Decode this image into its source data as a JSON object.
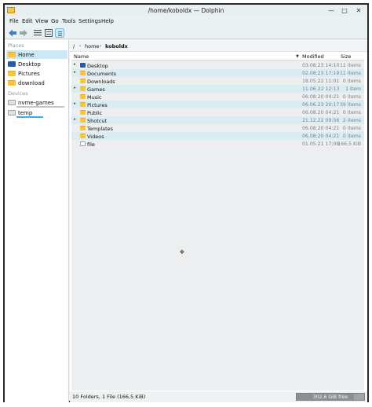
{
  "window": {
    "title": "/home/koboldx — Dolphin",
    "controls": {
      "minimize": "—",
      "maximize": "□",
      "close": "✕"
    }
  },
  "menubar": [
    "File",
    "Edit",
    "View",
    "Go",
    "Tools",
    "Settings",
    "Help"
  ],
  "toolbar": [
    "back-icon",
    "forward-icon",
    "icons-view-icon",
    "compact-view-icon",
    "details-view-icon"
  ],
  "sidebar": {
    "places_title": "Places",
    "places": [
      {
        "label": "Home",
        "icon": "home-folder-icon",
        "selected": true
      },
      {
        "label": "Desktop",
        "icon": "desktop-folder-icon",
        "selected": false
      },
      {
        "label": "Pictures",
        "icon": "pictures-folder-icon",
        "selected": false
      },
      {
        "label": "download",
        "icon": "download-folder-icon",
        "selected": false
      }
    ],
    "devices_title": "Devices",
    "devices": [
      {
        "label": "nvme-games",
        "icon": "drive-icon",
        "used_fraction": 0.98
      },
      {
        "label": "temp",
        "icon": "drive-icon",
        "used_fraction": 0.45
      }
    ]
  },
  "breadcrumb": {
    "root": "/",
    "items": [
      "home",
      "koboldx"
    ]
  },
  "columns": {
    "name": "Name",
    "modified": "Modified",
    "size": "Size"
  },
  "files": [
    {
      "name": "Desktop",
      "modified": "03.08.23 14:10",
      "size": "11 items",
      "expandable": true,
      "icon": "desktop-folder-icon"
    },
    {
      "name": "Documents",
      "modified": "02.08.23 17:19",
      "size": "11 items",
      "expandable": true,
      "icon": "folder-icon"
    },
    {
      "name": "Downloads",
      "modified": "18.05.22 11:01",
      "size": "0 items",
      "expandable": false,
      "icon": "folder-icon"
    },
    {
      "name": "Games",
      "modified": "11.06.22 12:13",
      "size": "1 item",
      "expandable": true,
      "icon": "folder-icon"
    },
    {
      "name": "Music",
      "modified": "06.08.20 04:21",
      "size": "0 items",
      "expandable": false,
      "icon": "folder-icon"
    },
    {
      "name": "Pictures",
      "modified": "06.06.23 20:17",
      "size": "39 items",
      "expandable": true,
      "icon": "folder-icon"
    },
    {
      "name": "Public",
      "modified": "06.08.20 04:21",
      "size": "0 items",
      "expandable": false,
      "icon": "folder-icon"
    },
    {
      "name": "Shotcut",
      "modified": "21.12.22 09:56",
      "size": "2 items",
      "expandable": true,
      "icon": "folder-icon"
    },
    {
      "name": "Templates",
      "modified": "06.08.20 04:21",
      "size": "0 items",
      "expandable": false,
      "icon": "folder-icon"
    },
    {
      "name": "Videos",
      "modified": "06.08.20 04:21",
      "size": "0 items",
      "expandable": false,
      "icon": "folder-icon"
    },
    {
      "name": "file",
      "modified": "01.05.21 17:06",
      "size": "166,5 KiB",
      "expandable": false,
      "icon": "file-icon"
    }
  ],
  "status": {
    "text": "10 Folders, 1 File (166,5 KiB)",
    "free_space": "302,6 GiB free",
    "used_fraction": 0.85
  },
  "colors": {
    "selection": "#cce8f4",
    "alt_row": "#d9edf3",
    "accent": "#3daee9"
  }
}
